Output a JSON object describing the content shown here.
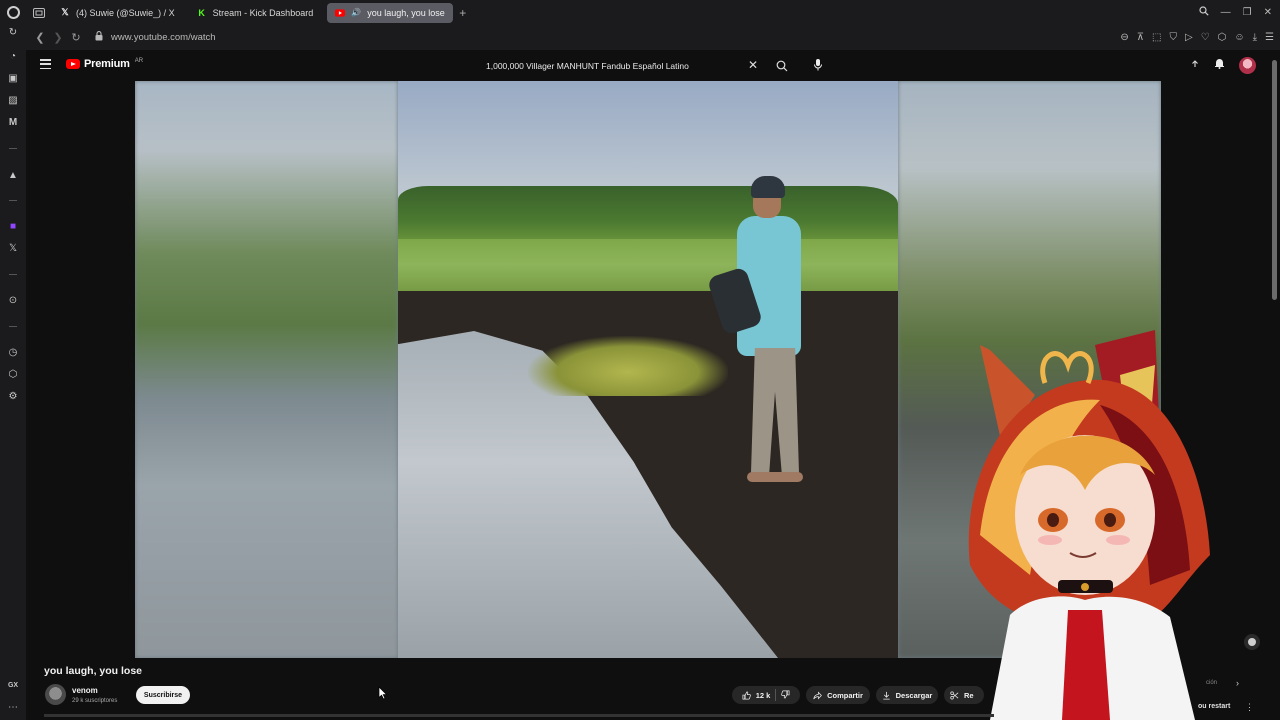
{
  "browser": {
    "tabs": [
      {
        "label": "(4) Suwie (@Suwie_) / X",
        "icon": "x-logo-icon"
      },
      {
        "label": "Stream - Kick Dashboard",
        "icon": "kick-logo-icon"
      },
      {
        "label": "you laugh, you lose -",
        "icon": "youtube-logo-icon",
        "active": true
      }
    ],
    "new_tab_label": "+",
    "url": "www.youtube.com/watch",
    "sidebar_bottom_label": "GX"
  },
  "youtube": {
    "logo_text": "Premium",
    "logo_country": "AR",
    "search_value": "1,000,000 Villager MANHUNT Fandub Español Latino",
    "video": {
      "title": "you laugh, you lose",
      "channel_name": "venom",
      "channel_subs": "29 k suscriptores",
      "subscribe_label": "Suscribirse",
      "like_count": "12 k",
      "share_label": "Compartir",
      "download_label": "Descargar",
      "clip_label": "Re"
    },
    "sidebar_panel": {
      "faint_label": "ción",
      "restart_label": "ou restart"
    }
  },
  "colors": {
    "background": "#0f0f0f",
    "browser_chrome": "#1b1b1d",
    "youtube_red": "#ff0000",
    "pill_bg": "#272727",
    "active_tab": "#5b5c63"
  }
}
